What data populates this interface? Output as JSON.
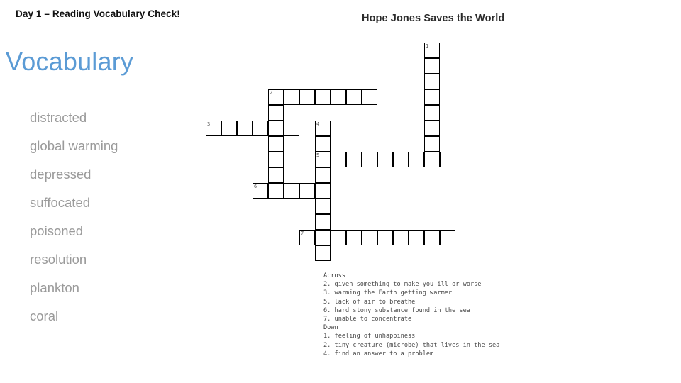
{
  "slide": {
    "header": "Day 1 – Reading  Vocabulary Check!",
    "vocab_heading": "Vocabulary",
    "heading_color": "#5B9BD5",
    "list_color": "#9a9a9a"
  },
  "vocabulary": [
    "distracted",
    "global warming",
    "depressed",
    "suffocated",
    "poisoned",
    "resolution",
    "plankton",
    "coral"
  ],
  "crossword": {
    "title": "Hope Jones Saves the World",
    "cell_size": 22,
    "across_heading": "Across",
    "down_heading": "Down",
    "across": [
      {
        "num": "2",
        "clue": "2. given something to make you ill or worse"
      },
      {
        "num": "3",
        "clue": "3. warming the Earth getting warmer"
      },
      {
        "num": "5",
        "clue": "5. lack of air to breathe"
      },
      {
        "num": "6",
        "clue": "6. hard stony substance found in the sea"
      },
      {
        "num": "7",
        "clue": "7. unable to concentrate"
      }
    ],
    "down": [
      {
        "num": "1",
        "clue": "1. feeling of unhappiness"
      },
      {
        "num": "2",
        "clue": "2. tiny creature (microbe) that lives in the sea"
      },
      {
        "num": "4",
        "clue": "4. find an answer to a problem"
      }
    ],
    "entries": [
      {
        "name": "1-down",
        "num": "1",
        "dir": "down",
        "col": 14,
        "row": 0,
        "len": 8
      },
      {
        "name": "2-across",
        "num": "2",
        "dir": "across",
        "col": 4,
        "row": 3,
        "len": 7
      },
      {
        "name": "2-down",
        "num": "2",
        "dir": "down",
        "col": 4,
        "row": 3,
        "len": 7
      },
      {
        "name": "3-across",
        "num": "3",
        "dir": "across",
        "col": 0,
        "row": 5,
        "len": 6
      },
      {
        "name": "4-down",
        "num": "4",
        "dir": "down",
        "col": 7,
        "row": 5,
        "len": 9
      },
      {
        "name": "5-across",
        "num": "5",
        "dir": "across",
        "col": 7,
        "row": 7,
        "len": 9
      },
      {
        "name": "6-across",
        "num": "6",
        "dir": "across",
        "col": 3,
        "row": 9,
        "len": 5
      },
      {
        "name": "7-across",
        "num": "7",
        "dir": "across",
        "col": 6,
        "row": 12,
        "len": 10
      }
    ]
  }
}
